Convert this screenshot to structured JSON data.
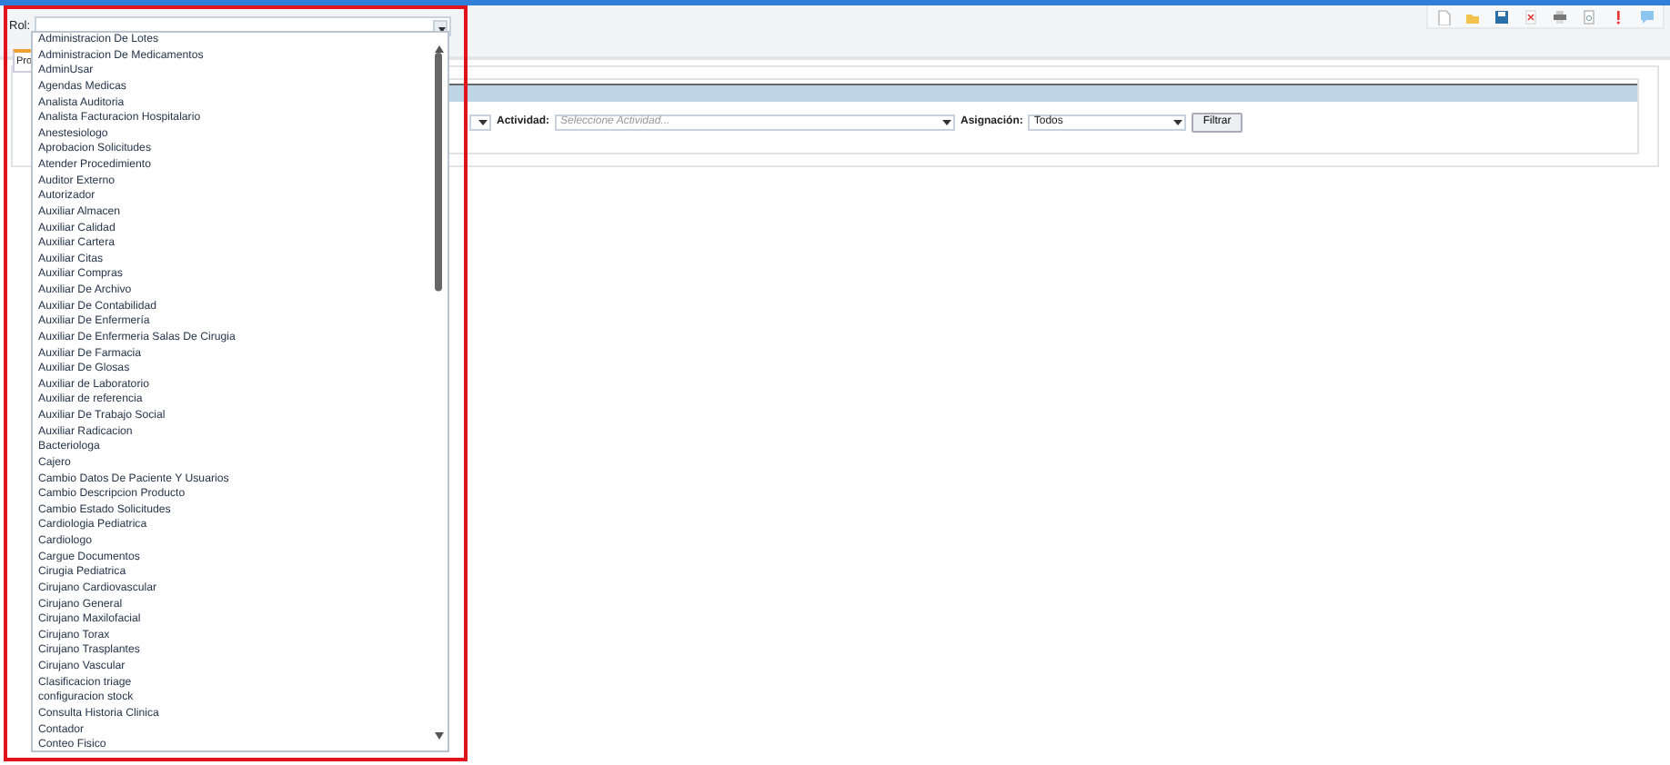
{
  "rol_field": {
    "label": "Rol:"
  },
  "tab": {
    "label": "Pro",
    "selected": true
  },
  "filters": {
    "actividad": {
      "label": "Actividad:",
      "placeholder": "Seleccione Actividad..."
    },
    "asignacion": {
      "label": "Asignación:",
      "value": "Todos"
    },
    "button": "Filtrar"
  },
  "dropdown_items": [
    "Administracion De Lotes",
    "Administracion De Medicamentos",
    "AdminUsar",
    "Agendas Medicas",
    "Analista Auditoria",
    "Analista Facturacion Hospitalario",
    "Anestesiologo",
    "Aprobacion Solicitudes",
    "Atender Procedimiento",
    "Auditor Externo",
    "Autorizador",
    "Auxiliar Almacen",
    "Auxiliar Calidad",
    "Auxiliar Cartera",
    "Auxiliar Citas",
    "Auxiliar Compras",
    "Auxiliar De Archivo",
    "Auxiliar De Contabilidad",
    "Auxiliar De Enfermería",
    "Auxiliar De Enfermeria Salas De Cirugia",
    "Auxiliar De Farmacia",
    "Auxiliar De Glosas",
    "Auxiliar de Laboratorio",
    "Auxiliar de referencia",
    "Auxiliar De Trabajo Social",
    "Auxiliar Radicacion",
    "Bacteriologa",
    "Cajero",
    "Cambio Datos De Paciente Y Usuarios",
    "Cambio Descripcion Producto",
    "Cambio Estado Solicitudes",
    "Cardiologia Pediatrica",
    "Cardiologo",
    "Cargue Documentos",
    "Cirugia Pediatrica",
    "Cirujano Cardiovascular",
    "Cirujano General",
    "Cirujano Maxilofacial",
    "Cirujano Torax",
    "Cirujano Trasplantes",
    "Cirujano Vascular",
    "Clasificacion triage",
    "configuracion stock",
    "Consulta Historia Clinica",
    "Contador",
    "Conteo Fisico"
  ]
}
